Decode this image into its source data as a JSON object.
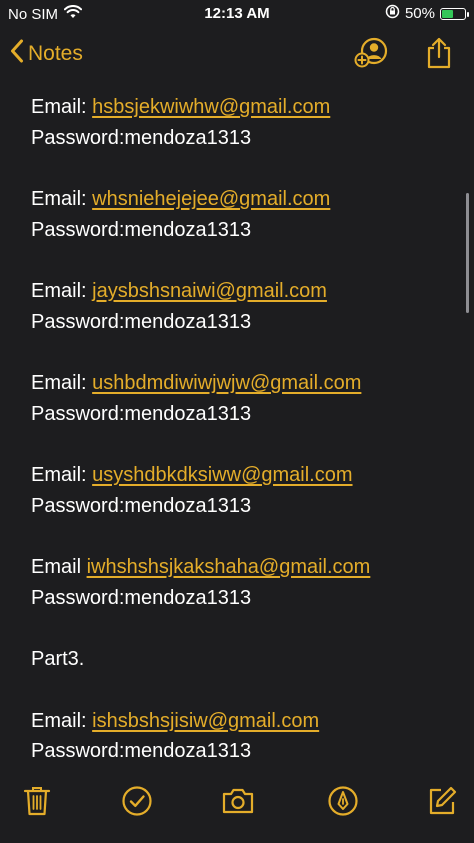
{
  "status_bar": {
    "carrier": "No SIM",
    "time": "12:13 AM",
    "battery_percent": "50%",
    "battery_level": 0.5
  },
  "nav": {
    "back_label": "Notes"
  },
  "note": {
    "entries": [
      {
        "prefix": "Email: ",
        "email": "hsbsjekwiwhw@gmail.com",
        "password": "Password:mendoza1313"
      },
      {
        "prefix": "Email: ",
        "email": "whsniehejejee@gmail.com",
        "password": "Password:mendoza1313"
      },
      {
        "prefix": "Email: ",
        "email": "jaysbshsnaiwi@gmail.com",
        "password": "Password:mendoza1313"
      },
      {
        "prefix": "Email: ",
        "email": "ushbdmdiwiwjwjw@gmail.com",
        "password": "Password:mendoza1313"
      },
      {
        "prefix": "Email: ",
        "email": "usyshdbkdksiww@gmail.com",
        "password": "Password:mendoza1313"
      },
      {
        "prefix": "Email ",
        "email": "iwhshshsjkakshaha@gmail.com",
        "password": "Password:mendoza1313"
      }
    ],
    "section_heading": "Part3.",
    "entries_after": [
      {
        "prefix": "Email: ",
        "email": "ishsbshsjisiw@gmail.com",
        "password": "Password:mendoza1313"
      }
    ]
  },
  "colors": {
    "accent": "#e4ad2a",
    "background": "#1d1d1f",
    "text": "#ffffff"
  },
  "icons": {
    "wifi": "wifi-icon",
    "rotation_lock": "rotation-lock-icon",
    "battery": "battery-charging-icon",
    "back": "chevron-left-icon",
    "add_people": "add-people-icon",
    "share": "share-icon",
    "delete": "trash-icon",
    "checklist": "checklist-icon",
    "camera": "camera-icon",
    "markup": "markup-pen-icon",
    "compose": "compose-icon"
  }
}
